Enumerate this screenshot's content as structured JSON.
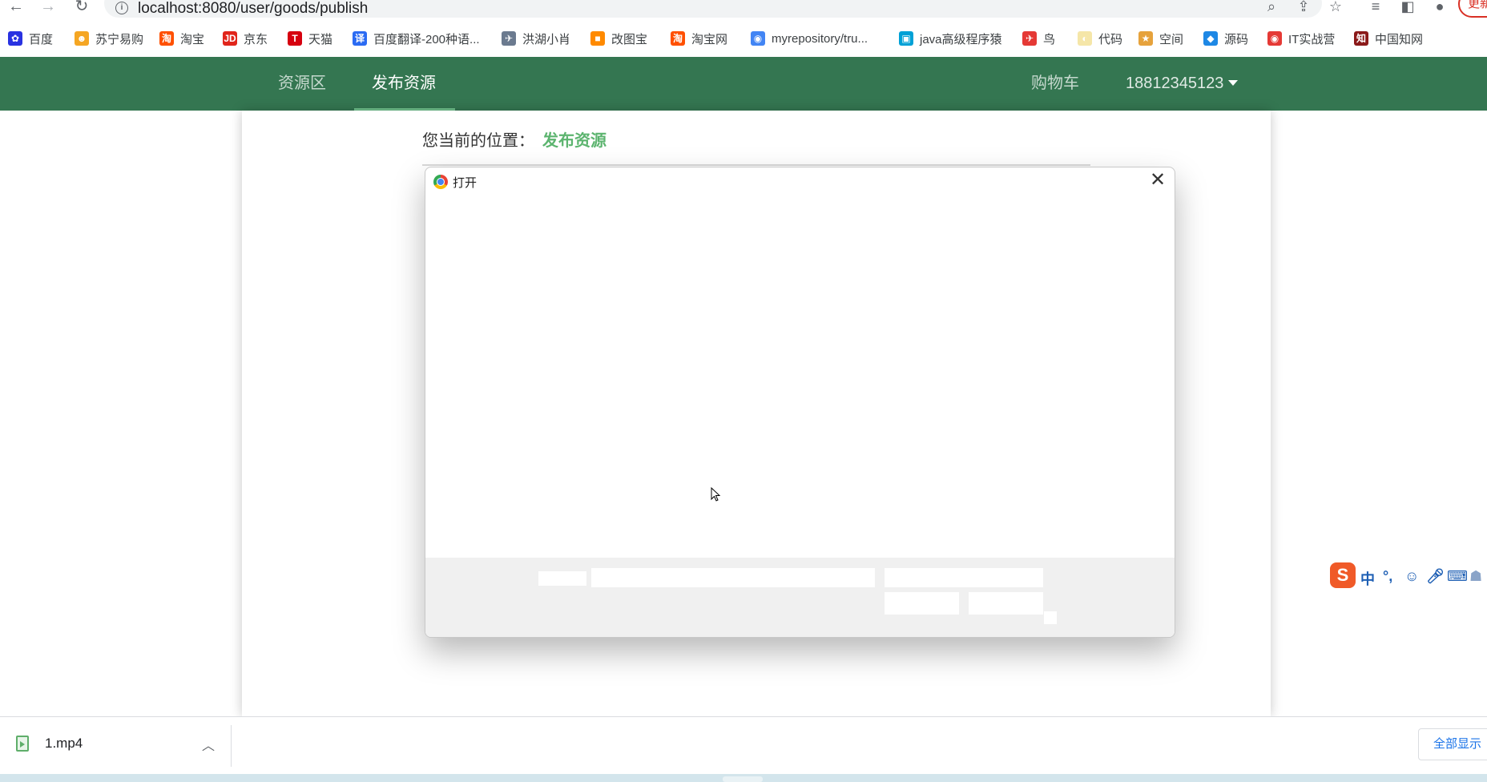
{
  "browser": {
    "url": "localhost:8080/user/goods/publish",
    "update_label": "更新",
    "bookmarks": [
      {
        "label": "百度",
        "icon": "baidu-paw-icon",
        "color": "#2932e1"
      },
      {
        "label": "苏宁易购",
        "icon": "suning-icon",
        "color": "#f5a623"
      },
      {
        "label": "淘宝",
        "icon": "taobao-icon",
        "color": "#ff5000"
      },
      {
        "label": "京东",
        "icon": "jd-icon",
        "color": "#e1251b"
      },
      {
        "label": "天猫",
        "icon": "tmall-icon",
        "color": "#d6000f"
      },
      {
        "label": "百度翻译-200种语...",
        "icon": "translate-icon",
        "color": "#2b6bf3"
      },
      {
        "label": "洪湖小肖",
        "icon": "bird-icon",
        "color": "#6b7a8f"
      },
      {
        "label": "改图宝",
        "icon": "gaitubao-icon",
        "color": "#ff8a00"
      },
      {
        "label": "淘宝网",
        "icon": "taobao-icon",
        "color": "#ff5000"
      },
      {
        "label": "myrepository/tru...",
        "icon": "chrome-icon",
        "color": "#4285f4"
      },
      {
        "label": "java高级程序猿",
        "icon": "bilibili-icon",
        "color": "#00a1d6"
      },
      {
        "label": "鸟",
        "icon": "red-bird-icon",
        "color": "#e53935"
      },
      {
        "label": "代码",
        "icon": "moon-icon",
        "color": "#f5e6a8"
      },
      {
        "label": "空间",
        "icon": "qzone-icon",
        "color": "#e6a23c"
      },
      {
        "label": "源码",
        "icon": "fish-icon",
        "color": "#1e88e5"
      },
      {
        "label": "IT实战营",
        "icon": "it-icon",
        "color": "#e53935"
      },
      {
        "label": "中国知网",
        "icon": "cnki-icon",
        "color": "#8b1a1a"
      }
    ]
  },
  "navbar": {
    "bg": "#347651",
    "items": [
      {
        "label": "资源区",
        "active": false
      },
      {
        "label": "发布资源",
        "active": true
      }
    ],
    "cart_label": "购物车",
    "user_label": "18812345123"
  },
  "location": {
    "prefix": "您当前的位置：",
    "current": "发布资源"
  },
  "dialog": {
    "title": "打开",
    "close_glyph": "✕"
  },
  "download": {
    "filename": "1.mp4",
    "show_all_label": "全部显示"
  },
  "ime": {
    "logo": "S",
    "mode": "中",
    "punct": "°,"
  }
}
